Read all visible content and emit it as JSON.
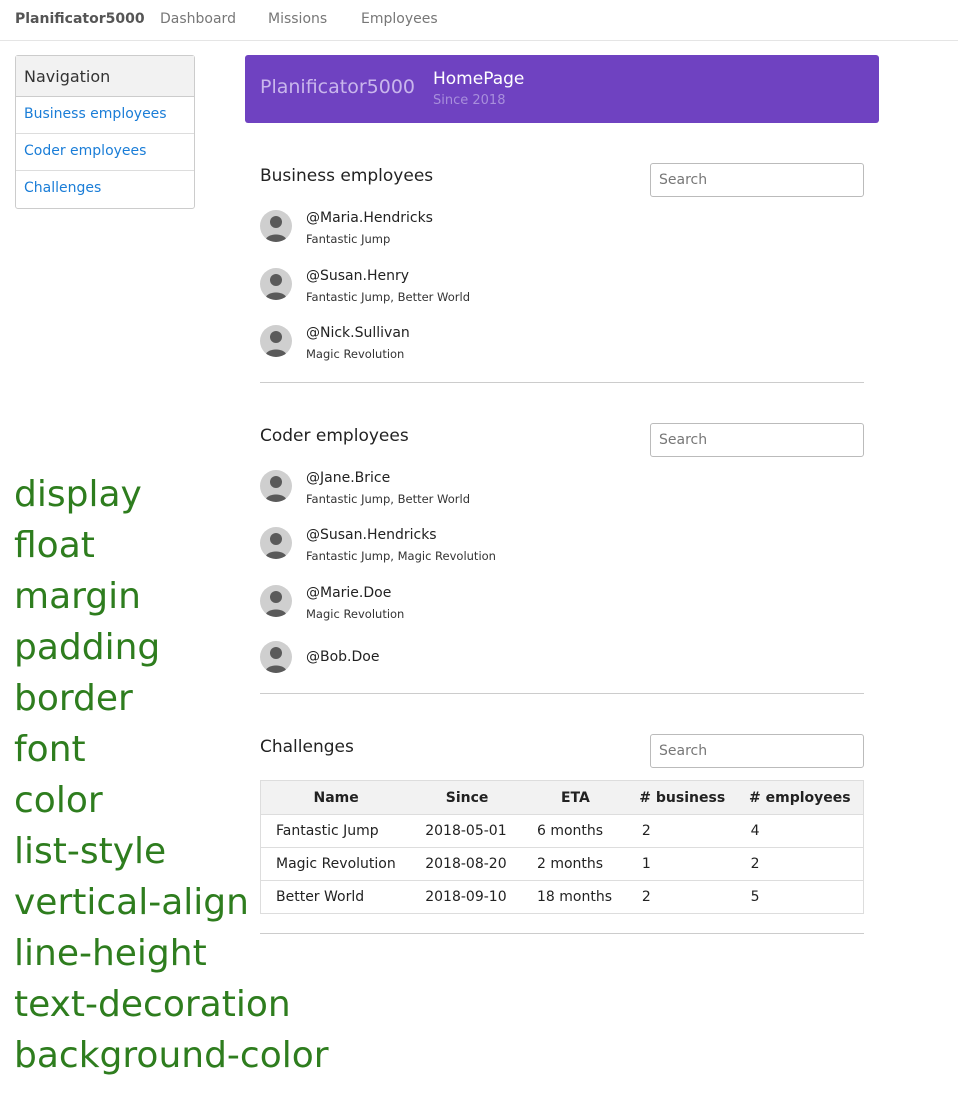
{
  "navbar": {
    "brand": "Planificator5000",
    "links": [
      "Dashboard",
      "Missions",
      "Employees"
    ]
  },
  "sidebar": {
    "heading": "Navigation",
    "items": [
      "Business employees",
      "Coder employees",
      "Challenges"
    ]
  },
  "css_words": [
    "display",
    "float",
    "margin",
    "padding",
    "border",
    "font",
    "color",
    "list-style",
    "vertical-align",
    "line-height",
    "text-decoration",
    "background-color"
  ],
  "banner": {
    "brand": "Planificator5000",
    "title": "HomePage",
    "subtitle": "Since 2018"
  },
  "business": {
    "title": "Business employees",
    "search_placeholder": "Search",
    "employees": [
      {
        "name": "@Maria.Hendricks",
        "challenges": "Fantastic Jump"
      },
      {
        "name": "@Susan.Henry",
        "challenges": "Fantastic Jump, Better World"
      },
      {
        "name": "@Nick.Sullivan",
        "challenges": "Magic Revolution"
      }
    ]
  },
  "coders": {
    "title": "Coder employees",
    "search_placeholder": "Search",
    "employees": [
      {
        "name": "@Jane.Brice",
        "challenges": "Fantastic Jump, Better World"
      },
      {
        "name": "@Susan.Hendricks",
        "challenges": "Fantastic Jump, Magic Revolution"
      },
      {
        "name": "@Marie.Doe",
        "challenges": "Magic Revolution"
      },
      {
        "name": "@Bob.Doe",
        "challenges": ""
      }
    ]
  },
  "challenges": {
    "title": "Challenges",
    "search_placeholder": "Search",
    "columns": [
      "Name",
      "Since",
      "ETA",
      "# business",
      "# employees"
    ],
    "rows": [
      [
        "Fantastic Jump",
        "2018-05-01",
        "6 months",
        "2",
        "4"
      ],
      [
        "Magic Revolution",
        "2018-08-20",
        "2 months",
        "1",
        "2"
      ],
      [
        "Better World",
        "2018-09-10",
        "18 months",
        "2",
        "5"
      ]
    ]
  }
}
